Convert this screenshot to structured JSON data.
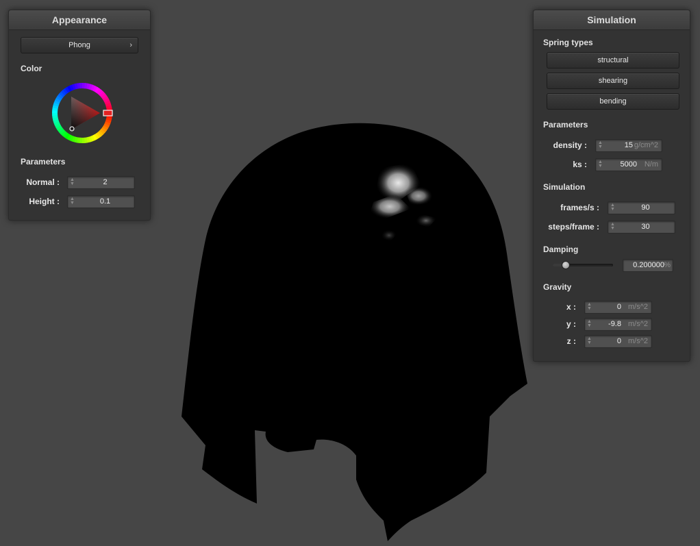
{
  "appearance": {
    "title": "Appearance",
    "shader": "Phong",
    "color_label": "Color",
    "parameters_label": "Parameters",
    "normal": {
      "label": "Normal :",
      "value": "2"
    },
    "height": {
      "label": "Height :",
      "value": "0.1"
    },
    "selected_color": "#e32222"
  },
  "simulation": {
    "title": "Simulation",
    "spring_types_label": "Spring types",
    "spring_types": [
      "structural",
      "shearing",
      "bending"
    ],
    "parameters_label": "Parameters",
    "density": {
      "label": "density :",
      "value": "15",
      "unit": "g/cm^2"
    },
    "ks": {
      "label": "ks :",
      "value": "5000",
      "unit": "N/m"
    },
    "simulation_label": "Simulation",
    "frames": {
      "label": "frames/s :",
      "value": "90"
    },
    "steps": {
      "label": "steps/frame :",
      "value": "30"
    },
    "damping_label": "Damping",
    "damping": {
      "value": "0.200000",
      "unit": "%",
      "slider_fraction": 0.2
    },
    "gravity_label": "Gravity",
    "gravity": [
      {
        "label": "x :",
        "value": "0",
        "unit": "m/s^2"
      },
      {
        "label": "y :",
        "value": "-9.8",
        "unit": "m/s^2"
      },
      {
        "label": "z :",
        "value": "0",
        "unit": "m/s^2"
      }
    ]
  },
  "colors": {
    "background": "#464646",
    "panel": "#333333",
    "cloth": "#000000"
  }
}
